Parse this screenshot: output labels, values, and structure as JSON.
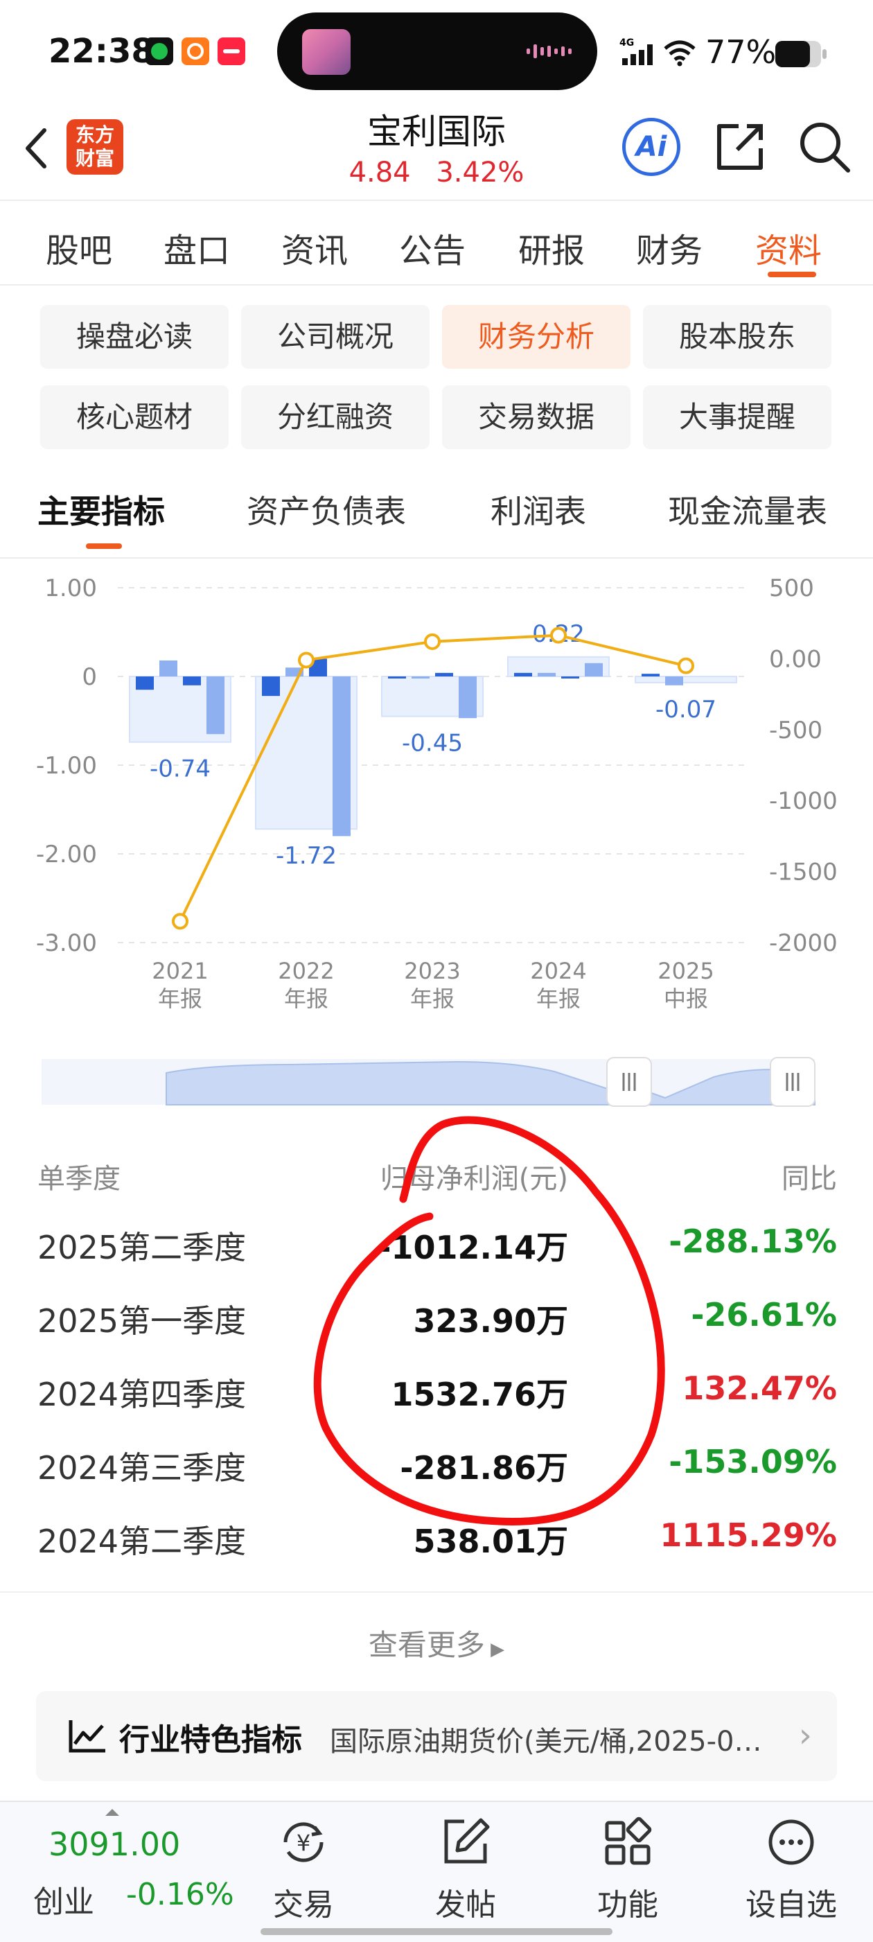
{
  "status_bar": {
    "time": "22:38",
    "network": "4G",
    "battery": "77%",
    "mini_apps": [
      {
        "name": "app-green",
        "color": "#1fbf4c"
      },
      {
        "name": "app-orange",
        "color": "#ff7a1a"
      },
      {
        "name": "xiaohongshu",
        "color": "#ff2442"
      }
    ]
  },
  "header": {
    "stock_name": "宝利国际",
    "price": "4.84",
    "change_pct": "3.42%",
    "logo_line1": "东方",
    "logo_line2": "财富",
    "ai_label": "Ai"
  },
  "main_tabs": [
    "股吧",
    "盘口",
    "资讯",
    "公告",
    "研报",
    "财务",
    "资料"
  ],
  "main_tab_active": "资料",
  "sub_tags": [
    "操盘必读",
    "公司概况",
    "财务分析",
    "股本股东",
    "核心题材",
    "分红融资",
    "交易数据",
    "大事提醒"
  ],
  "sub_tag_active": "财务分析",
  "indicator_tabs": [
    "主要指标",
    "资产负债表",
    "利润表",
    "现金流量表"
  ],
  "chart_data": {
    "type": "bar",
    "categories": [
      [
        "2021",
        "年报"
      ],
      [
        "2022",
        "年报"
      ],
      [
        "2023",
        "年报"
      ],
      [
        "2024",
        "年报"
      ],
      [
        "2025",
        "中报"
      ]
    ],
    "left_ticks": [
      "1.00",
      "0",
      "-1.00",
      "-2.00",
      "-3.00"
    ],
    "right_ticks": [
      "500",
      "0.00",
      "-500",
      "-1000",
      "-1500",
      "-2000"
    ],
    "ylim_left": [
      -3,
      1
    ],
    "ylim_right": [
      -2000,
      500
    ],
    "annual_values": [
      -0.74,
      -1.72,
      -0.45,
      0.22,
      -0.07
    ],
    "annual_labels": [
      "-0.74",
      "-1.72",
      "-0.45",
      "0.22",
      "-0.07"
    ],
    "quarter_values": [
      [
        -0.15,
        0.18,
        -0.1,
        -0.65
      ],
      [
        -0.22,
        0.1,
        0.2,
        -1.8
      ],
      [
        -0.01,
        -0.01,
        0.04,
        -0.47
      ],
      [
        0.04,
        0.04,
        -0.02,
        0.15
      ],
      [
        0.03,
        -0.1
      ]
    ],
    "line_values": [
      -1850,
      -10,
      120,
      165,
      -50
    ],
    "colors": {
      "bar_dark": "#2a64d6",
      "bar_light": "#8fb0f0",
      "annual_fill": "#e8effd",
      "line": "#f0ad14"
    }
  },
  "table": {
    "headers": {
      "period": "单季度",
      "value": "归母净利润(元)",
      "yoy": "同比"
    },
    "rows": [
      {
        "period": "2025第二季度",
        "value": "-1012.14万",
        "yoy": "-288.13%",
        "trend": "down"
      },
      {
        "period": "2025第一季度",
        "value": "323.90万",
        "yoy": "-26.61%",
        "trend": "down"
      },
      {
        "period": "2024第四季度",
        "value": "1532.76万",
        "yoy": "132.47%",
        "trend": "up"
      },
      {
        "period": "2024第三季度",
        "value": "-281.86万",
        "yoy": "-153.09%",
        "trend": "down"
      },
      {
        "period": "2024第二季度",
        "value": "538.01万",
        "yoy": "1115.29%",
        "trend": "up"
      }
    ]
  },
  "see_more": "查看更多",
  "industry": {
    "title": "行业特色指标",
    "desc": "国际原油期货价(美元/桶,2025-0…"
  },
  "bottom_nav": {
    "index_value": "3091.00",
    "index_name": "创业",
    "index_change": "-0.16%",
    "items": [
      {
        "label": "交易",
        "icon": "yen-cycle-icon"
      },
      {
        "label": "发帖",
        "icon": "edit-icon"
      },
      {
        "label": "功能",
        "icon": "grid-icon"
      },
      {
        "label": "设自选",
        "icon": "more-dots-icon"
      }
    ]
  }
}
